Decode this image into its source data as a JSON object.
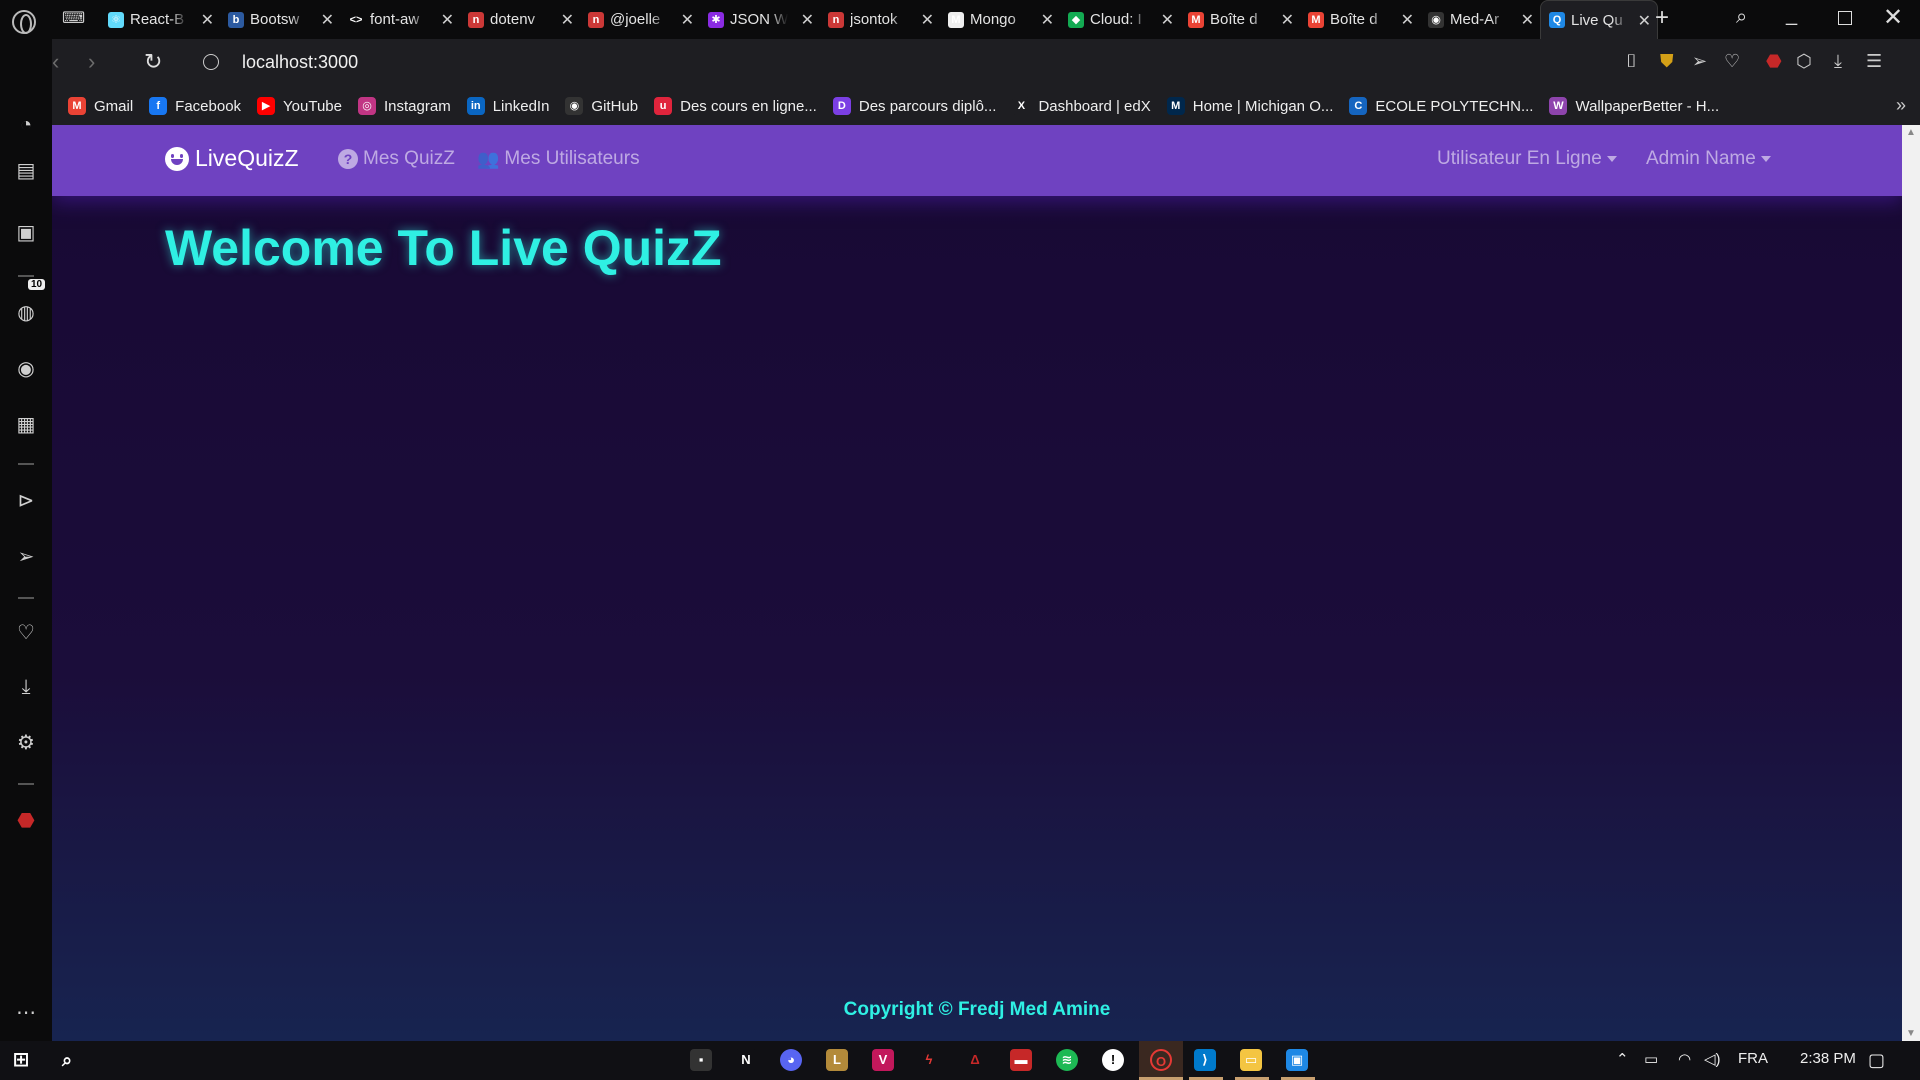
{
  "browser": {
    "tabs": [
      {
        "title": "React-B",
        "fav_color": "#61dafb",
        "fav": "⚛"
      },
      {
        "title": "Bootsw",
        "fav_color": "#2c5aa0",
        "fav": "b"
      },
      {
        "title": "font-aw",
        "fav_color": "#0b0b0c",
        "fav": "<>"
      },
      {
        "title": "dotenv",
        "fav_color": "#cb3837",
        "fav": "n"
      },
      {
        "title": "@joelle",
        "fav_color": "#cb3837",
        "fav": "n"
      },
      {
        "title": "JSON W",
        "fav_color": "#8a2be2",
        "fav": "✱"
      },
      {
        "title": "jsontok",
        "fav_color": "#cb3837",
        "fav": "n"
      },
      {
        "title": "Mongo",
        "fav_color": "#eeeeee",
        "fav": "M"
      },
      {
        "title": "Cloud: I",
        "fav_color": "#13aa52",
        "fav": "◆"
      },
      {
        "title": "Boîte d",
        "fav_color": "#ea4335",
        "fav": "M"
      },
      {
        "title": "Boîte d",
        "fav_color": "#ea4335",
        "fav": "M"
      },
      {
        "title": "Med-Ar",
        "fav_color": "#333333",
        "fav": "◉"
      },
      {
        "title": "Live Qu",
        "fav_color": "#1e88e5",
        "fav": "Q"
      }
    ],
    "url": "localhost:3000"
  },
  "bookmarks": [
    {
      "label": "Gmail",
      "fav_color": "#ea4335",
      "fav": "M"
    },
    {
      "label": "Facebook",
      "fav_color": "#1877f2",
      "fav": "f"
    },
    {
      "label": "YouTube",
      "fav_color": "#ff0000",
      "fav": "▶"
    },
    {
      "label": "Instagram",
      "fav_color": "#c13584",
      "fav": "◎"
    },
    {
      "label": "LinkedIn",
      "fav_color": "#0a66c2",
      "fav": "in"
    },
    {
      "label": "GitHub",
      "fav_color": "#333333",
      "fav": "◉"
    },
    {
      "label": "Des cours en ligne...",
      "fav_color": "#e0243c",
      "fav": "u"
    },
    {
      "label": "Des parcours diplô...",
      "fav_color": "#7b3fe4",
      "fav": "D"
    },
    {
      "label": "Dashboard | edX",
      "fav_color": "#1e1e22",
      "fav": "X"
    },
    {
      "label": "Home | Michigan O...",
      "fav_color": "#00274c",
      "fav": "M"
    },
    {
      "label": "ECOLE POLYTECHN...",
      "fav_color": "#1565c0",
      "fav": "C"
    },
    {
      "label": "WallpaperBetter - H...",
      "fav_color": "#8e44ad",
      "fav": "W"
    }
  ],
  "sidebar": {
    "badge": "10"
  },
  "app": {
    "brand": "LiveQuizZ",
    "nav_quiz": "Mes QuizZ",
    "nav_users": "Mes Utilisateurs",
    "online_users": "Utilisateur En Ligne",
    "admin_name": "Admin Name",
    "welcome": "Welcome To Live QuizZ",
    "copyright": "Copyright © Fredj Med Amine",
    "accent_color": "#6f42c1",
    "heading_color": "#2ff0e3"
  },
  "taskbar": {
    "language": "FRA",
    "time": "2:38 PM"
  }
}
